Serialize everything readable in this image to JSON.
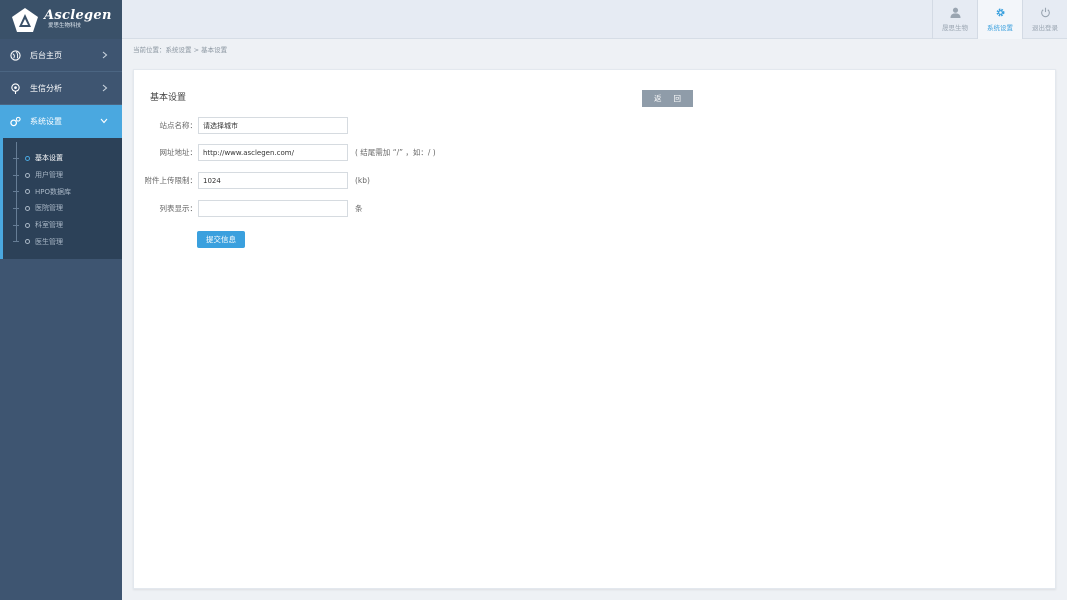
{
  "logo": {
    "name": "Asclegen",
    "subtitle": "爱思生物科技"
  },
  "sidebar": {
    "items": [
      {
        "label": "后台主页",
        "icon": "globe-icon"
      },
      {
        "label": "生信分析",
        "icon": "pin-icon"
      },
      {
        "label": "系统设置",
        "icon": "gears-icon"
      }
    ],
    "sub_items": [
      {
        "label": "基本设置"
      },
      {
        "label": "用户管理"
      },
      {
        "label": "HPO数据库"
      },
      {
        "label": "医院管理"
      },
      {
        "label": "科室管理"
      },
      {
        "label": "医生管理"
      }
    ]
  },
  "topbar": {
    "actions": [
      {
        "label": "晟思生物",
        "icon": "user-icon"
      },
      {
        "label": "系统设置",
        "icon": "gear-icon"
      },
      {
        "label": "退出登录",
        "icon": "power-icon"
      }
    ]
  },
  "breadcrumb": "当前位置：系统设置 > 基本设置",
  "panel": {
    "title": "基本设置",
    "back_label": "返 回",
    "submit_label": "提交信息",
    "fields": [
      {
        "label": "站点名称：",
        "value": "请选择城市",
        "hint": ""
      },
      {
        "label": "网址地址：",
        "value": "http://www.asclegen.com/",
        "hint": "( 结尾需加 “/” ，如：/ )"
      },
      {
        "label": "附件上传限制：",
        "value": "1024",
        "hint": "(kb)"
      },
      {
        "label": "列表显示：",
        "value": "",
        "hint": "条"
      }
    ]
  },
  "colors": {
    "accent": "#4aa8e0",
    "sidebar": "#3e5571",
    "sidebar_dark": "#2c4158",
    "back_button": "#8f9ca9"
  }
}
